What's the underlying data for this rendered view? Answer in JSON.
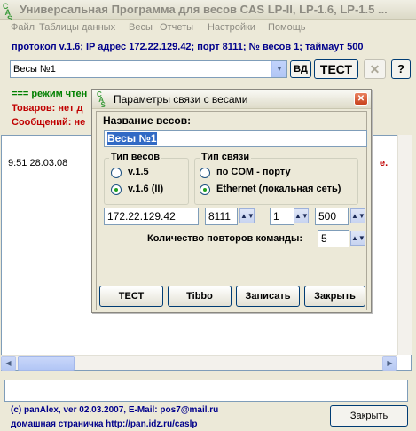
{
  "window": {
    "title": "Универсальная Программа для весов CAS LP-II, LP-1.6, LP-1.5 ...",
    "icon_text": "CAS"
  },
  "menu": [
    "Файл",
    "Таблицы данных",
    "Весы",
    "Отчеты",
    "Настройки",
    "Помощь"
  ],
  "status_line": "протокол v.1.6; IP адрес 172.22.129.42; порт 8111; № весов 1; таймаут 500",
  "scale_select": {
    "value": "Весы №1"
  },
  "toolbar": {
    "vd_label": "ВД",
    "test_label": "ТЕСТ",
    "x_label": "✕",
    "help_label": "?"
  },
  "info": {
    "mode": "=== режим чтен",
    "goods": "Товаров: нет д",
    "messages": "Сообщений: не"
  },
  "log": {
    "time": "9:51 28.03.08",
    "tail": "е."
  },
  "footer": {
    "copyright": "(c) panAlex, ver 02.03.2007, E-Mail: pos7@mail.ru",
    "homepage": "домашная страничка http://pan.idz.ru/caslp",
    "close_label": "Закрыть"
  },
  "dialog": {
    "title": "Параметры связи с весами",
    "name_label": "Название весов:",
    "name_value": "Весы №1",
    "scale_type": {
      "label": "Тип весов",
      "options": [
        "v.1.5",
        "v.1.6 (II)"
      ],
      "selected": 1
    },
    "conn_type": {
      "label": "Тип связи",
      "options": [
        "по COM - порту",
        "Ethernet (локальная сеть)"
      ],
      "selected": 1
    },
    "ip": "172.22.129.42",
    "port": "8111",
    "scale_no": "1",
    "timeout": "500",
    "retry_label": "Количество повторов команды:",
    "retry_value": "5",
    "buttons": {
      "test": "ТЕСТ",
      "tibbo": "Tibbo",
      "save": "Записать",
      "close": "Закрыть"
    }
  }
}
